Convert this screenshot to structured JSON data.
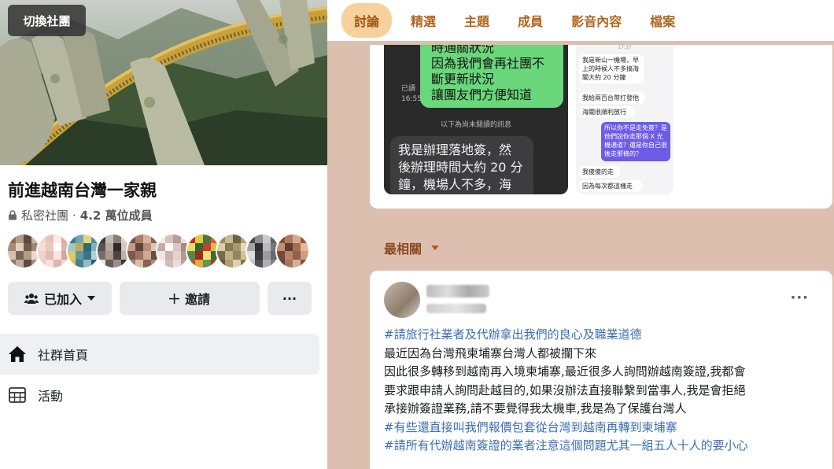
{
  "group": {
    "switch_label": "切換社團",
    "name": "前進越南台灣一家親",
    "privacy": "私密社團",
    "separator": "·",
    "members": "4.2 萬位成員"
  },
  "actions": {
    "joined_label": "已加入",
    "invite_label": "邀請",
    "more_label": "···"
  },
  "nav": {
    "home_label": "社群首頁",
    "events_label": "活動"
  },
  "tabs": [
    "討論",
    "精選",
    "主題",
    "成員",
    "影音內容",
    "檔案"
  ],
  "chat": {
    "green_lines": [
      "時通關狀況",
      "因為我們會再社團不",
      "斷更新狀況",
      "讓團友們方便知道"
    ],
    "read_label": "已讀",
    "time": "16:55",
    "divider": "以下為尚未閱讀的訊息",
    "gray_lines": [
      "我是辦理落地簽，然",
      "後辦理時間大約 20 分",
      "鐘，機場人不多，海"
    ],
    "right_time": "17:37",
    "right_msgs": [
      "我是新山一機場，早上的時候人不多搞海關大約 20 分鐘",
      "我給兩百台幣打發他",
      "海關很順利放行",
      "所以你不是走免簽？是他們說你走那個 X 光機通道？還是你自己很後走那條的？",
      "我傻傻的走",
      "因為每次都這樣走"
    ]
  },
  "sort": {
    "label": "最相關"
  },
  "post": {
    "more_label": "···",
    "lines": [
      {
        "text": "#請旅行社業者及代辦拿出我們的良心及職業道德",
        "tag": true
      },
      {
        "text": "最近因為台灣飛柬埔寨台灣人都被攔下來",
        "tag": false
      },
      {
        "text": "因此很多轉移到越南再入境柬埔寨,最近很多人詢問辦越南簽證,我都會",
        "tag": false
      },
      {
        "text": "要求跟申請人詢問赴越目的,如果沒辦法直接聯繫到當事人,我是會拒絕",
        "tag": false
      },
      {
        "text": "承接辦簽證業務,請不要覺得我太機車,我是為了保護台灣人",
        "tag": false
      },
      {
        "text": "#有些還直接叫我們報價包套從台灣到越南再轉到柬埔寨",
        "tag": true
      },
      {
        "text": "#請所有代辦越南簽證的業者注意這個問題尤其一組五人十人的要小心",
        "tag": true
      }
    ]
  },
  "colors": {
    "page_bg": "#dcbfae",
    "tab_text": "#b0651f",
    "tab_active_bg": "#f7d19b",
    "hashtag": "#3b6fb6",
    "chat_green": "#69d77a"
  },
  "icons": [
    "lock-icon",
    "people-icon",
    "caret-down-icon",
    "plus-icon",
    "home-icon",
    "calendar-icon",
    "sort-caret-icon"
  ]
}
